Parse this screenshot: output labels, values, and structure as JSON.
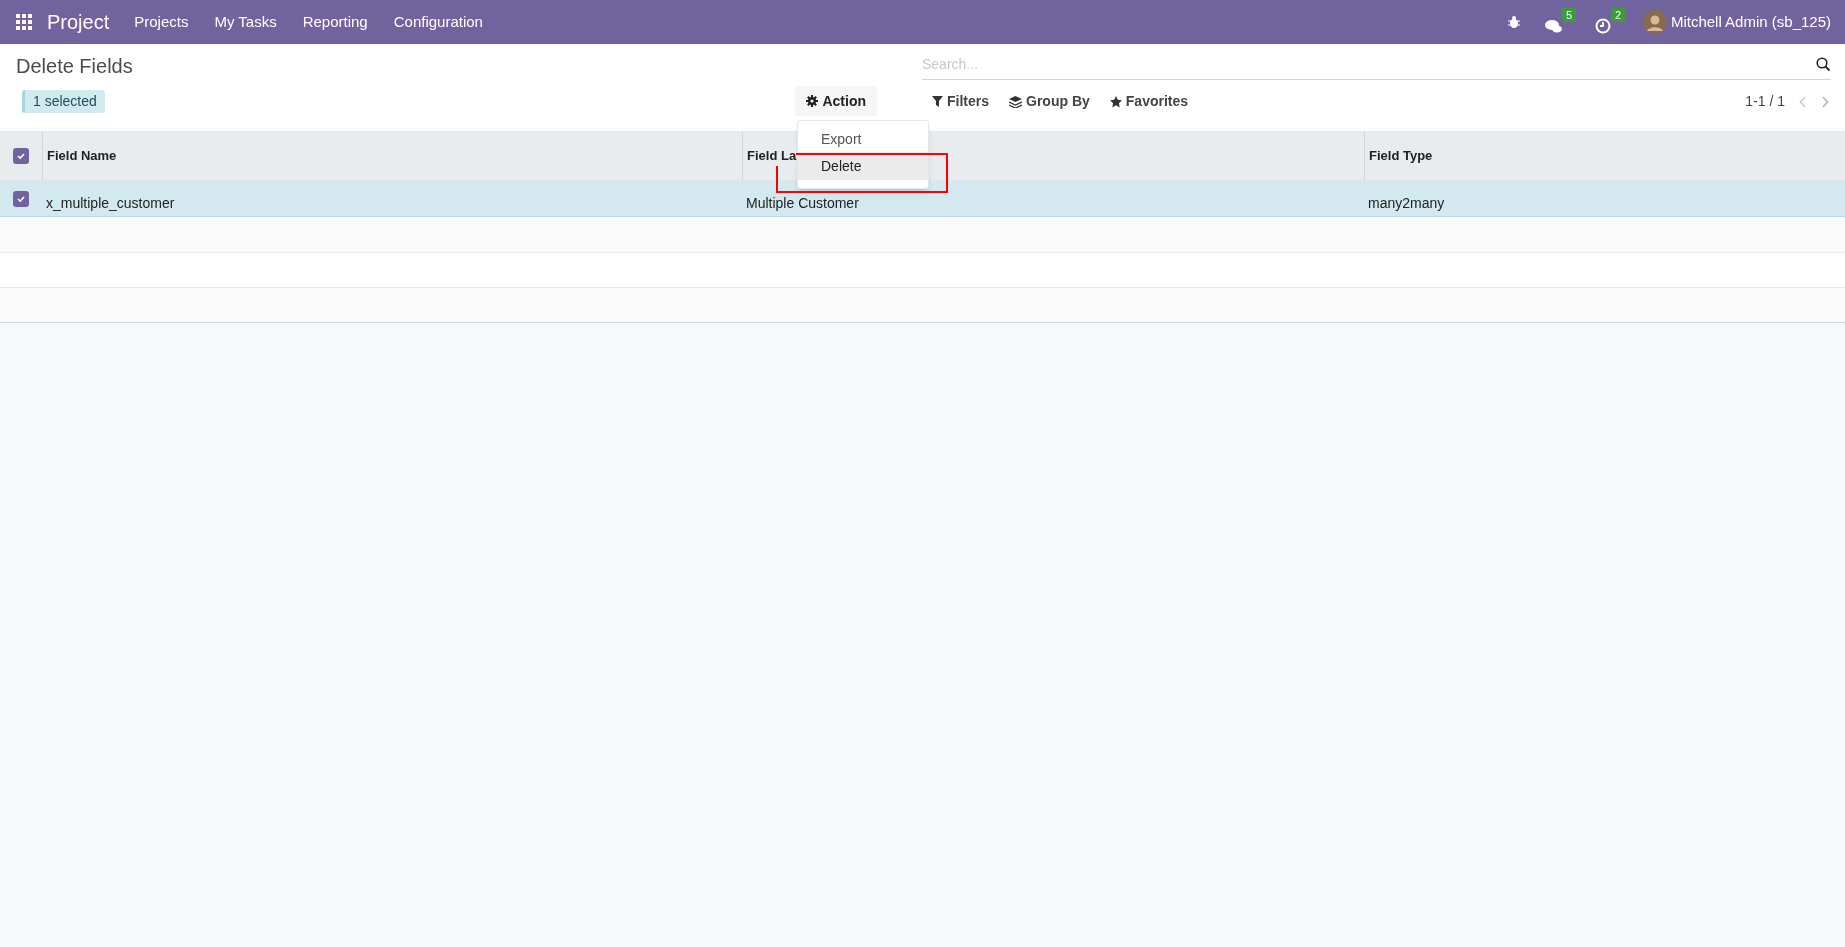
{
  "navbar": {
    "app_name": "Project",
    "menu": [
      "Projects",
      "My Tasks",
      "Reporting",
      "Configuration"
    ],
    "message_count": "5",
    "activity_count": "2",
    "user": "Mitchell Admin (sb_125)"
  },
  "title": "Delete Fields",
  "selection_badge": "1 selected",
  "action_button": "Action",
  "action_menu": [
    {
      "label": "Export",
      "selected": false
    },
    {
      "label": "Delete",
      "selected": true
    }
  ],
  "search": {
    "placeholder": "Search..."
  },
  "filters": [
    {
      "kind": "filter",
      "label": "Filters"
    },
    {
      "kind": "group",
      "label": "Group By"
    },
    {
      "kind": "favorite",
      "label": "Favorites"
    }
  ],
  "pager": "1-1 / 1",
  "table": {
    "all_checked": true,
    "columns": [
      "Field Name",
      "Field La",
      "Field Type"
    ],
    "rows": [
      {
        "checked": true,
        "selected": true,
        "cells": [
          "x_multiple_customer",
          "Multiple Customer",
          "many2many"
        ]
      }
    ]
  }
}
